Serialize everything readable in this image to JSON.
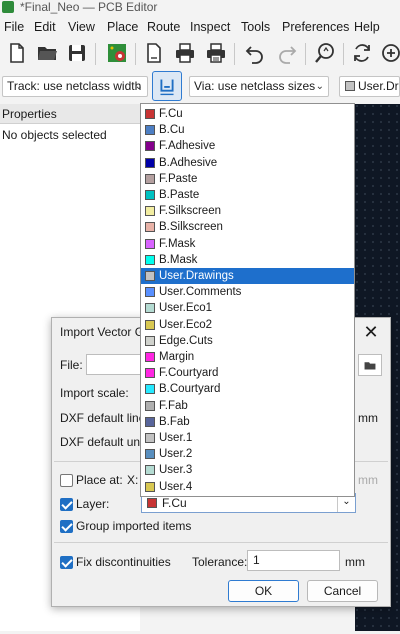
{
  "window": {
    "title": "*Final_Neo — PCB Editor"
  },
  "menu": [
    "File",
    "Edit",
    "View",
    "Place",
    "Route",
    "Inspect",
    "Tools",
    "Preferences",
    "Help"
  ],
  "toolbar2": {
    "track": "Track: use netclass width",
    "via": "Via: use netclass sizes",
    "layer_partial": "User.Dra"
  },
  "properties": {
    "header": "Properties",
    "empty": "No objects selected"
  },
  "dialog": {
    "title": "Import Vector G",
    "file_label": "File:",
    "import_scale_label": "Import scale:",
    "dxf_line_label": "DXF default line",
    "dxf_unit_label": "DXF default unit",
    "dxf_line_unit": "mm",
    "place_at_label": "Place at:",
    "x_label": "X:",
    "place_at_unit": "mm",
    "layer_label": "Layer:",
    "layer_value": "F.Cu",
    "group_label": "Group imported items",
    "fix_label": "Fix discontinuities",
    "tolerance_label": "Tolerance:",
    "tolerance_value": "1",
    "tolerance_unit": "mm",
    "ok": "OK",
    "cancel": "Cancel"
  },
  "layers": [
    {
      "name": "F.Cu",
      "color": "#c83434"
    },
    {
      "name": "B.Cu",
      "color": "#4d7fc4"
    },
    {
      "name": "F.Adhesive",
      "color": "#84008c"
    },
    {
      "name": "B.Adhesive",
      "color": "#0000a8"
    },
    {
      "name": "F.Paste",
      "color": "#b4a0a0"
    },
    {
      "name": "B.Paste",
      "color": "#00c2c2"
    },
    {
      "name": "F.Silkscreen",
      "color": "#f2eda1"
    },
    {
      "name": "B.Silkscreen",
      "color": "#e8b2a7"
    },
    {
      "name": "F.Mask",
      "color": "#d864ff"
    },
    {
      "name": "B.Mask",
      "color": "#02ffee"
    },
    {
      "name": "User.Drawings",
      "color": "#c2c2c2"
    },
    {
      "name": "User.Comments",
      "color": "#5990ff"
    },
    {
      "name": "User.Eco1",
      "color": "#b4dbd2"
    },
    {
      "name": "User.Eco2",
      "color": "#d8c852"
    },
    {
      "name": "Edge.Cuts",
      "color": "#d0d2cd"
    },
    {
      "name": "Margin",
      "color": "#ff26e2"
    },
    {
      "name": "F.Courtyard",
      "color": "#ff26e2"
    },
    {
      "name": "B.Courtyard",
      "color": "#26e9ff"
    },
    {
      "name": "F.Fab",
      "color": "#afafaf"
    },
    {
      "name": "B.Fab",
      "color": "#58659b"
    },
    {
      "name": "User.1",
      "color": "#c2c2c2"
    },
    {
      "name": "User.2",
      "color": "#598fbf"
    },
    {
      "name": "User.3",
      "color": "#b4dbd2"
    },
    {
      "name": "User.4",
      "color": "#d8c852"
    }
  ],
  "selected_layer": "User.Drawings"
}
